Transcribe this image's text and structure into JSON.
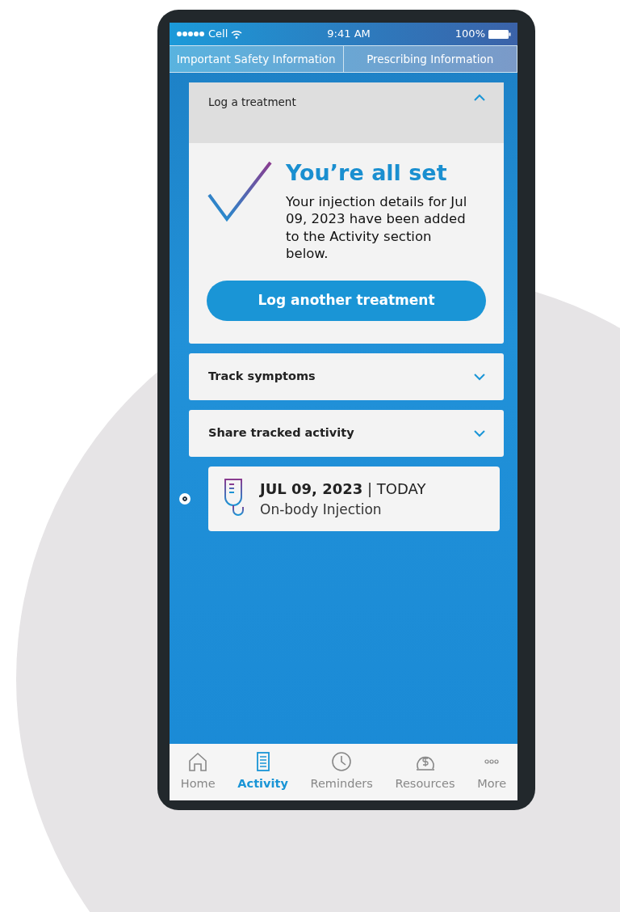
{
  "status_bar": {
    "carrier": "Cell",
    "time": "9:41 AM",
    "battery": "100%"
  },
  "header_links": [
    {
      "label": "Important Safety Information"
    },
    {
      "label": "Prescribing Information"
    }
  ],
  "accordions": [
    {
      "title": "Log a treatment",
      "expanded": true,
      "content": {
        "title": "You’re all set",
        "message": "Your injection details for Jul 09, 2023 have been added to the Activity section below.",
        "button": "Log another treatment"
      }
    },
    {
      "title": "Track symptoms",
      "expanded": false
    },
    {
      "title": "Share tracked activity",
      "expanded": false
    }
  ],
  "activity": [
    {
      "heading": "**JUL 09, 2023** | TODAY",
      "event": "On-body Injection"
    }
  ],
  "tab_bar": [
    {
      "kind": "home",
      "label": "Home",
      "selected": false
    },
    {
      "kind": "activity",
      "label": "Activity",
      "selected": true
    },
    {
      "kind": "reminders",
      "label": "Reminders",
      "selected": false
    },
    {
      "kind": "resources",
      "label": "Resources",
      "selected": false
    },
    {
      "kind": "more",
      "label": "More",
      "selected": false
    }
  ]
}
